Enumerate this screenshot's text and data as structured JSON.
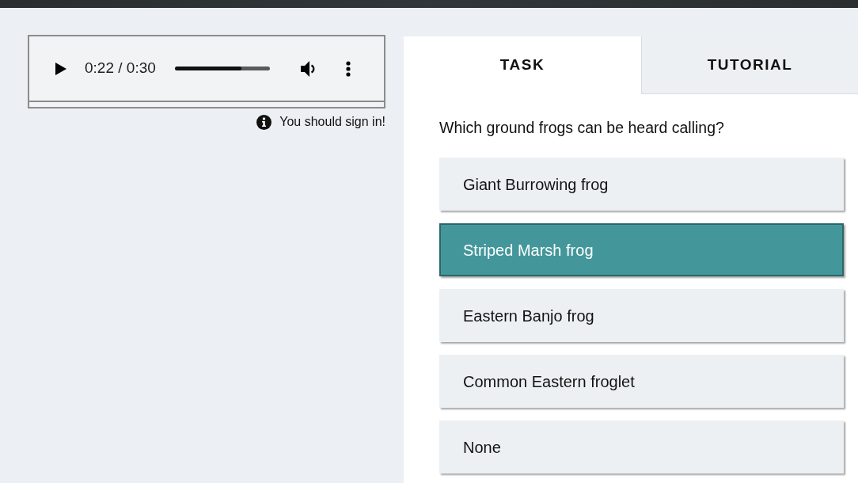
{
  "audio_player": {
    "time": "0:22 / 0:30",
    "level": 0.7
  },
  "notice": {
    "text": "You should sign in!"
  },
  "tabs": [
    {
      "label": "TASK",
      "selected": true
    },
    {
      "label": "TUTORIAL",
      "selected": false
    }
  ],
  "question": "Which ground frogs can be heard calling?",
  "options": [
    {
      "label": "Giant Burrowing frog",
      "selected": false
    },
    {
      "label": "Striped Marsh frog",
      "selected": true
    },
    {
      "label": "Eastern Banjo frog",
      "selected": false
    },
    {
      "label": "Common Eastern froglet",
      "selected": false
    },
    {
      "label": "None",
      "selected": false
    }
  ]
}
